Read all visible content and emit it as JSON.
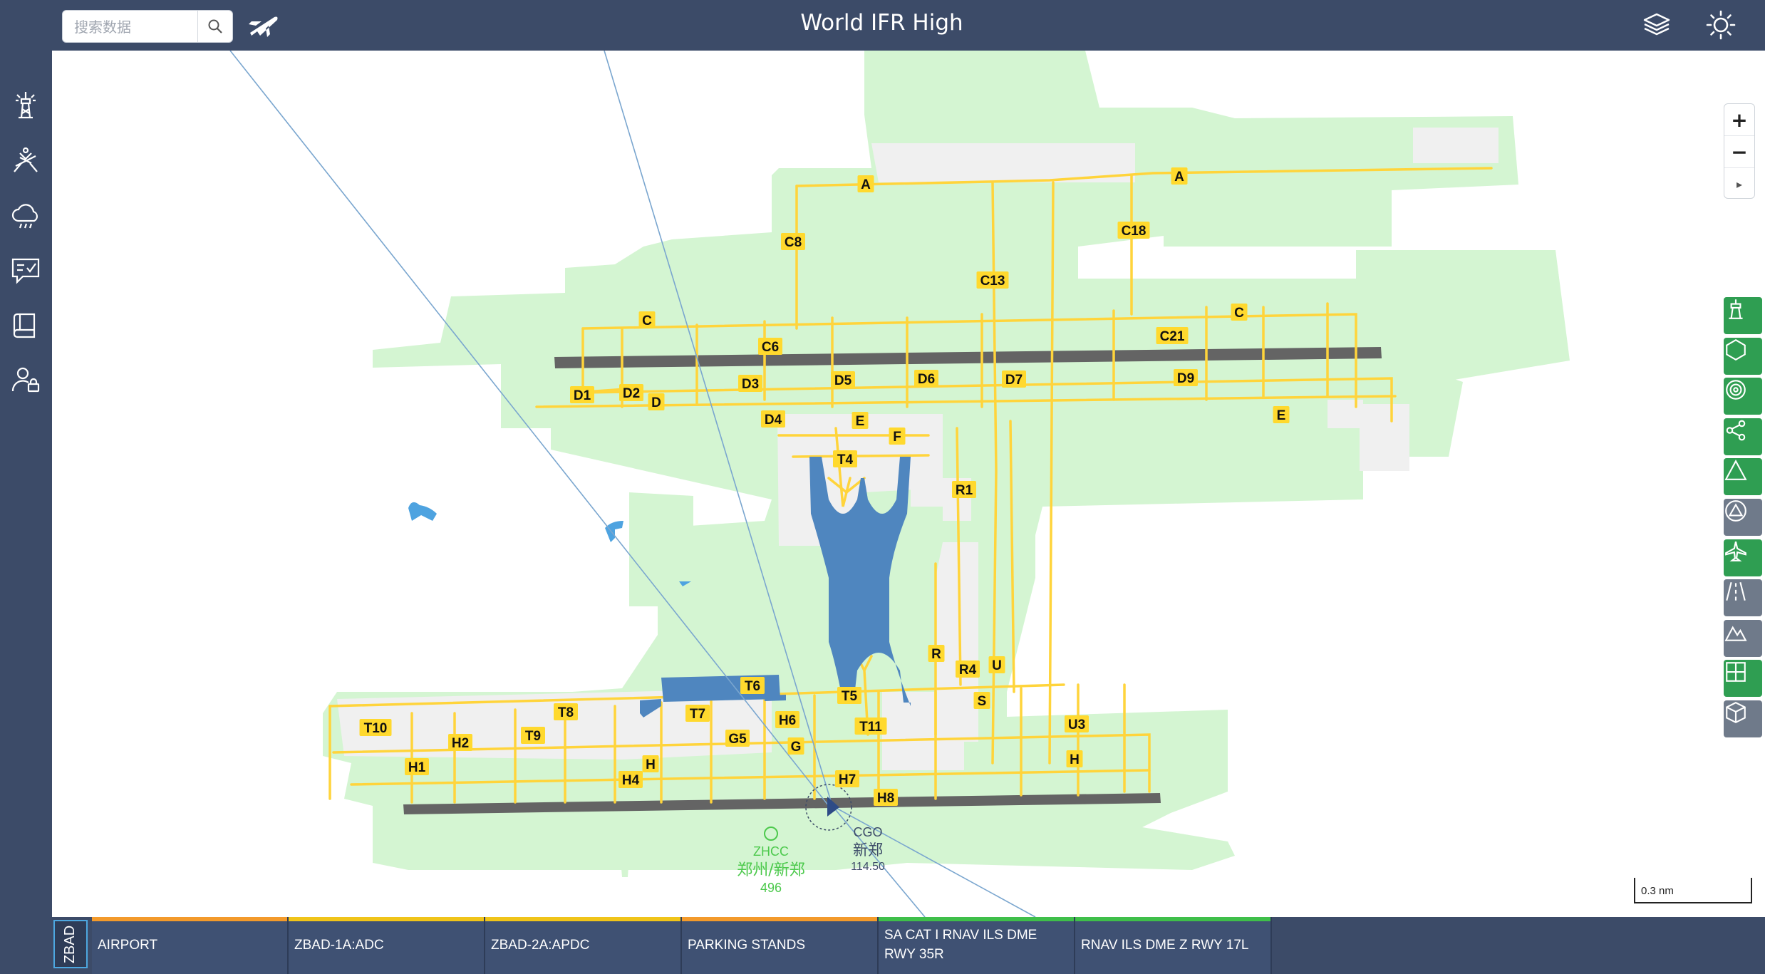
{
  "header": {
    "title": "World IFR High",
    "search_placeholder": "搜索数据",
    "icons": [
      "search-icon",
      "plane-icon",
      "layers-icon",
      "brightness-icon"
    ]
  },
  "sidebar": {
    "items": [
      "airport-tower-icon",
      "runway-traffic-icon",
      "weather-cloud-icon",
      "notam-checklist-icon",
      "manual-book-icon",
      "user-lock-icon"
    ]
  },
  "map_controls": {
    "zoom_in": "+",
    "zoom_out": "−",
    "north": "▸",
    "scale_label": "0.3 nm"
  },
  "layer_toolbar": [
    {
      "icon": "airport-tower-icon",
      "color": "#2f9e52"
    },
    {
      "icon": "hexagon-icon",
      "color": "#2f9e52"
    },
    {
      "icon": "vor-target-icon",
      "color": "#2f9e52"
    },
    {
      "icon": "share-network-icon",
      "color": "#2f9e52"
    },
    {
      "icon": "triangle-icon",
      "color": "#2f9e52"
    },
    {
      "icon": "triangle-circle-icon",
      "color": "#6f7a8a"
    },
    {
      "icon": "airplane-icon",
      "color": "#2f9e52"
    },
    {
      "icon": "road-icon",
      "color": "#6f7a8a"
    },
    {
      "icon": "mountain-icon",
      "color": "#6f7a8a"
    },
    {
      "icon": "grid-icon",
      "color": "#2f9e52"
    },
    {
      "icon": "box-3d-icon",
      "color": "#6f7a8a"
    }
  ],
  "map": {
    "colors": {
      "grass": "#d4f5d2",
      "apron": "#f0f0f0",
      "runway": "#646464",
      "taxiway": "#ffd43b",
      "terminal": "#4f86bf",
      "water": "#4ea3e0",
      "label_bg": "#ffd92e",
      "route": "#7aa6cf"
    },
    "taxiway_labels": [
      "A",
      "A",
      "C8",
      "C18",
      "C13",
      "C",
      "C",
      "C21",
      "C6",
      "D1",
      "D2",
      "D",
      "D3",
      "D5",
      "D6",
      "D7",
      "D9",
      "E",
      "D4",
      "E",
      "F",
      "T4",
      "R1",
      "R",
      "R4",
      "U",
      "S",
      "T6",
      "T5",
      "T7",
      "H6",
      "T11",
      "U3",
      "T10",
      "H2",
      "T8",
      "T9",
      "G5",
      "G",
      "H",
      "H",
      "H1",
      "H4",
      "H7",
      "H8"
    ],
    "navaids": [
      {
        "ident": "ZHCC",
        "name": "郑州/新郑",
        "value": "496",
        "color": "#4cc94c"
      },
      {
        "ident": "CGO",
        "name": "新郑",
        "value": "114.50",
        "color": "#3c4b68"
      }
    ]
  },
  "bottom": {
    "airport_code": "ZBAD",
    "tabs": [
      {
        "label": "AIRPORT",
        "color": "#f39a2b"
      },
      {
        "label": "ZBAD-1A:ADC",
        "color": "#f0c419"
      },
      {
        "label": "ZBAD-2A:APDC",
        "color": "#f0c419"
      },
      {
        "label": "PARKING STANDS",
        "color": "#f39a2b"
      },
      {
        "label": "SA CAT I RNAV ILS DME RWY 35R",
        "line1": "SA CAT I RNAV ILS DME",
        "line2": "RWY 35R",
        "color": "#3fbf4a"
      },
      {
        "label": "RNAV ILS DME Z RWY 17L",
        "color": "#3fbf4a"
      }
    ]
  }
}
